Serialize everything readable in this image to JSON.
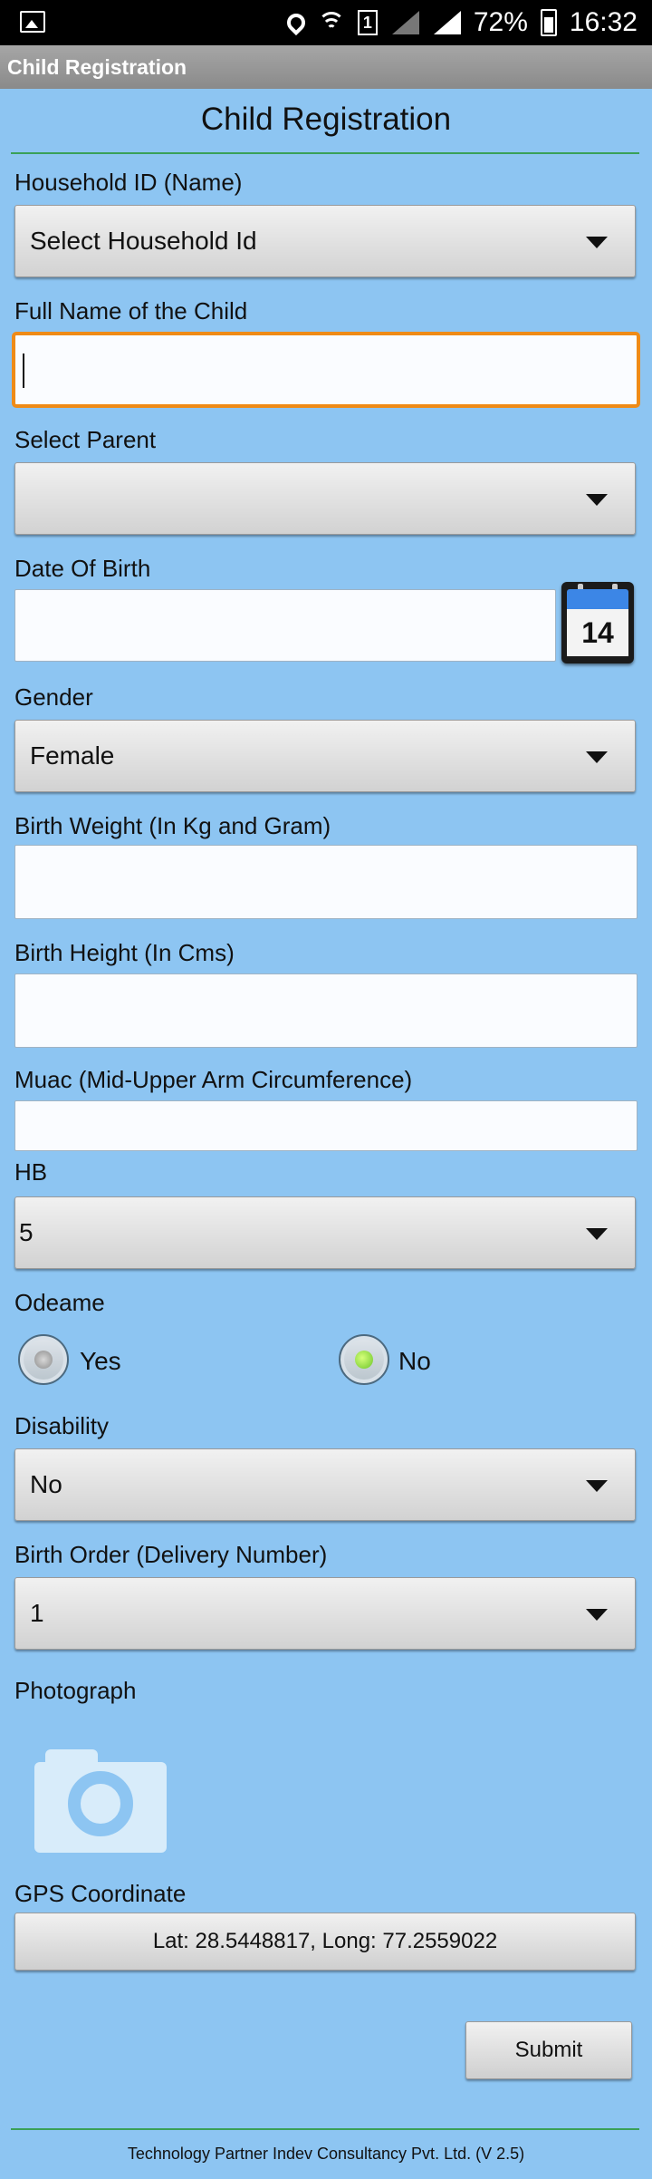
{
  "status_bar": {
    "battery_percent": "72%",
    "time": "16:32",
    "sim_slot": "1"
  },
  "action_bar": {
    "title": "Child Registration"
  },
  "form": {
    "heading": "Child Registration",
    "household": {
      "label": "Household ID (Name)",
      "value": "Select Household Id"
    },
    "child_name": {
      "label": "Full Name of the Child",
      "value": ""
    },
    "parent": {
      "label": "Select Parent",
      "value": ""
    },
    "dob": {
      "label": "Date Of Birth",
      "value": "",
      "calendar_day": "14"
    },
    "gender": {
      "label": "Gender",
      "value": "Female"
    },
    "birth_weight": {
      "label": "Birth Weight (In Kg and Gram)",
      "value": ""
    },
    "birth_height": {
      "label": "Birth Height (In Cms)",
      "value": ""
    },
    "muac": {
      "label": "Muac (Mid-Upper Arm Circumference)",
      "value": ""
    },
    "hb": {
      "label": "HB",
      "value": "5"
    },
    "odeame": {
      "label": "Odeame",
      "options": [
        "Yes",
        "No"
      ],
      "selected": "No"
    },
    "disability": {
      "label": "Disability",
      "value": "No"
    },
    "birth_order": {
      "label": "Birth Order (Delivery Number)",
      "value": "1"
    },
    "photograph": {
      "label": "Photograph"
    },
    "gps": {
      "label": "GPS  Coordinate",
      "value": "Lat: 28.5448817, Long: 77.2559022"
    },
    "submit_label": "Submit"
  },
  "footer": {
    "text": "Technology Partner Indev Consultancy Pvt. Ltd. (V 2.5)"
  },
  "colors": {
    "background": "#8dc5f2",
    "focus": "#ef8b17",
    "divider": "#3aa058"
  }
}
